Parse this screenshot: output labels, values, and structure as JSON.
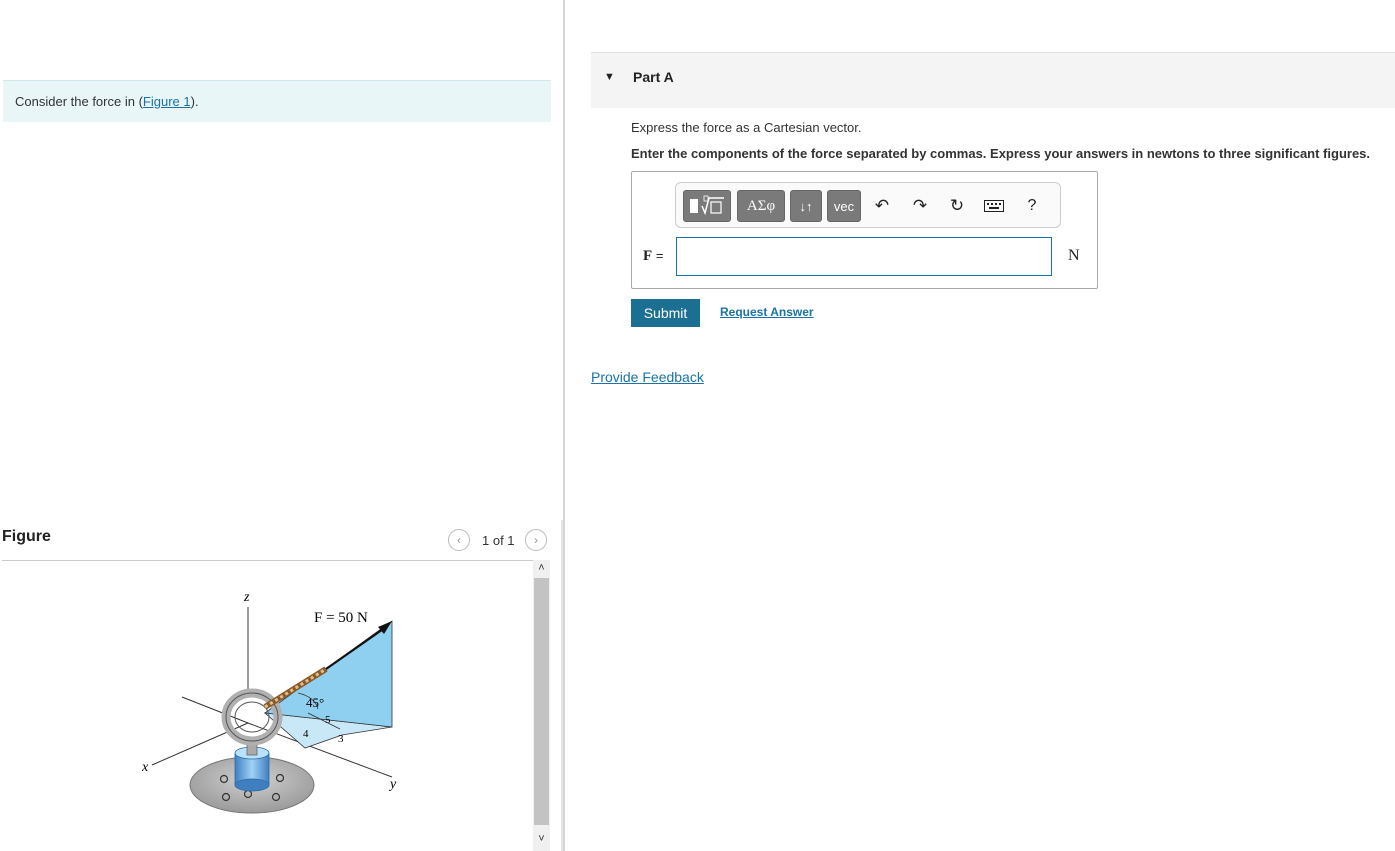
{
  "intro": {
    "prefix": "Consider the force in (",
    "link": "Figure 1",
    "suffix": ")."
  },
  "figure": {
    "title": "Figure",
    "pager": "1 of 1",
    "prev_icon": "chevron-left-icon",
    "next_icon": "chevron-right-icon",
    "labels": {
      "z": "z",
      "x": "x",
      "y": "y",
      "force": "F = 50 N",
      "angle": "45°",
      "tri_hyp": "5",
      "tri_a": "4",
      "tri_b": "3"
    }
  },
  "part": {
    "title": "Part A"
  },
  "question": {
    "prompt": "Express the force as a Cartesian vector.",
    "instructions": "Enter the components of the force separated by commas. Express your answers in newtons to three significant figures.",
    "var_label": "F",
    "equals": "=",
    "unit": "N",
    "answer_value": ""
  },
  "toolbar": {
    "templates_icon": "templates-icon",
    "greek_label": "ΑΣφ",
    "arrows_label": "↓↑",
    "vec_label": "vec",
    "undo_icon": "undo-icon",
    "redo_icon": "redo-icon",
    "reset_icon": "reset-icon",
    "keyboard_icon": "keyboard-icon",
    "help_label": "?"
  },
  "actions": {
    "submit": "Submit",
    "request": "Request Answer",
    "feedback": "Provide Feedback"
  },
  "colors": {
    "accent": "#1b6f93",
    "link": "#1a73a8",
    "intro_bg": "#e8f6f8",
    "triangle": "#8fd0f0"
  }
}
